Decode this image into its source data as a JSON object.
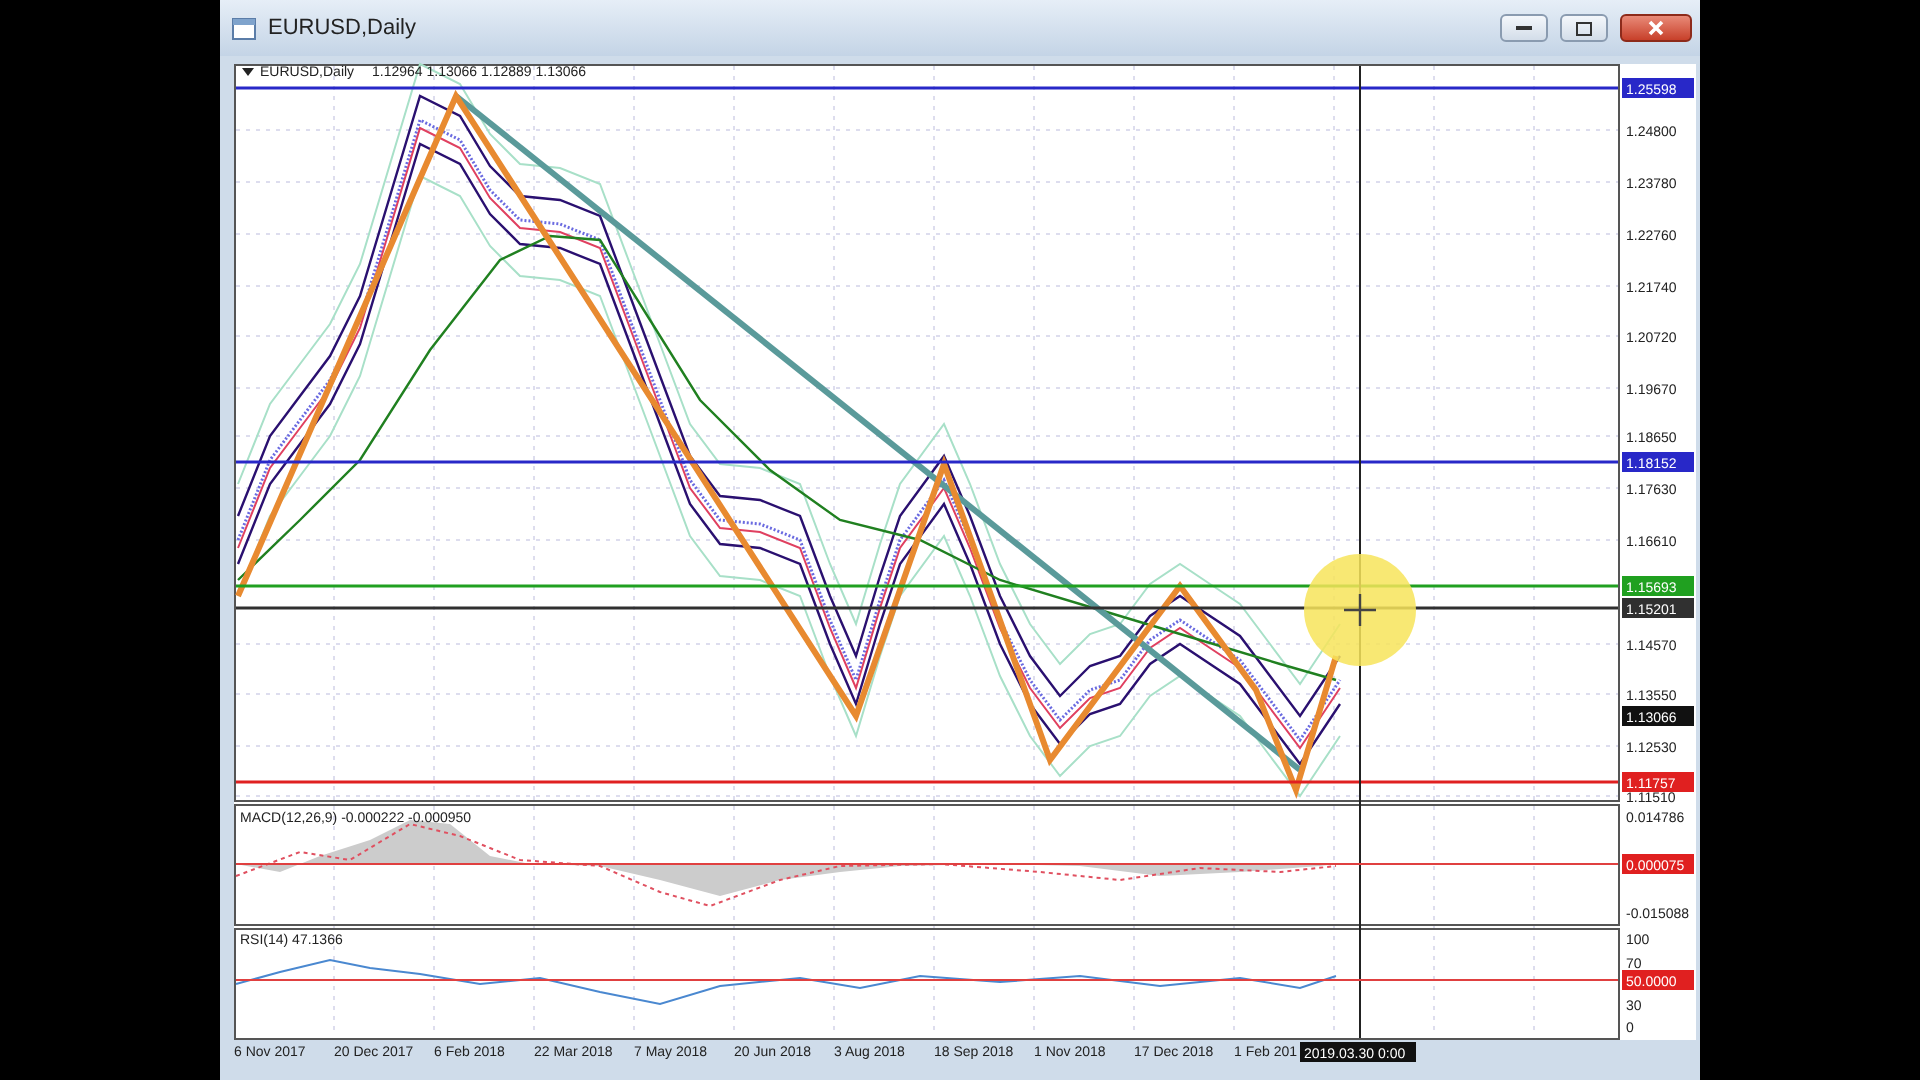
{
  "window": {
    "title": "EURUSD,Daily"
  },
  "main_panel": {
    "symbol": "EURUSD,Daily",
    "ohlc": "1.12964 1.13066 1.12889 1.13066",
    "price_ticks": [
      "1.24800",
      "1.23780",
      "1.22760",
      "1.21740",
      "1.20720",
      "1.19670",
      "1.18650",
      "1.17630",
      "1.16610",
      "1.14570",
      "1.13550",
      "1.12530",
      "1.11510"
    ],
    "levels": [
      {
        "label": "1.25598",
        "color": "#2828c8"
      },
      {
        "label": "1.18152",
        "color": "#2828c8"
      },
      {
        "label": "1.15693",
        "color": "#20a020"
      },
      {
        "label": "1.15201",
        "color": "#303030"
      },
      {
        "label": "1.11757",
        "color": "#e02020"
      }
    ],
    "current_price": "1.13066"
  },
  "macd_panel": {
    "title": "MACD(12,26,9) -0.000222 -0.000950",
    "ticks": [
      "0.014786",
      "-0.015088"
    ],
    "level": "0.000075"
  },
  "rsi_panel": {
    "title": "RSI(14) 47.1366",
    "ticks": [
      "100",
      "70",
      "30",
      "0"
    ],
    "level": "50.0000"
  },
  "date_ticks": [
    "6 Nov 2017",
    "20 Dec 2017",
    "6 Feb 2018",
    "22 Mar 2018",
    "7 May 2018",
    "20 Jun 2018",
    "3 Aug 2018",
    "18 Sep 2018",
    "1 Nov 2018",
    "17 Dec 2018",
    "1 Feb 201"
  ],
  "cursor_date": "2019.03.30 0:00"
}
